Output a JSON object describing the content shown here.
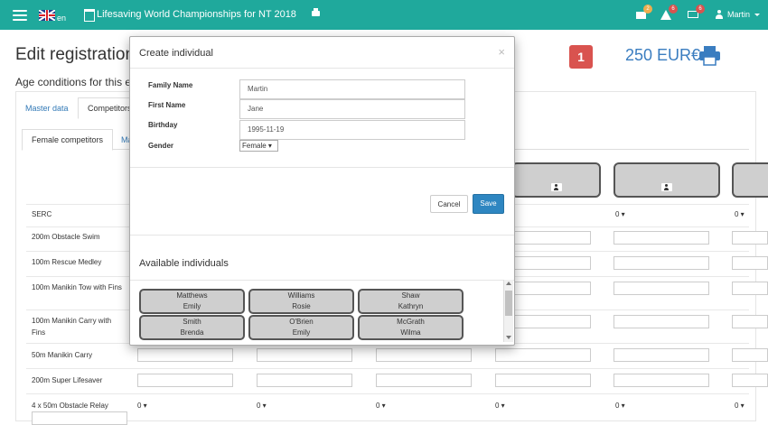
{
  "nav": {
    "lang": "en",
    "title": "Lifesaving World Championships for NT 2018",
    "username": "Martin",
    "badges": {
      "messages": "2",
      "alerts": "6",
      "payments": "6"
    },
    "colors": {
      "bar": "#1fa99c",
      "messages_badge": "#f0ad4e",
      "alerts_badge": "#d9534f"
    }
  },
  "page": {
    "title": "Edit registration",
    "age_text": "Age conditions for this eve",
    "count_badge": "1",
    "price": "250 EUR€",
    "tabs": [
      "Master data",
      "Competitors"
    ],
    "subtabs": [
      "Female competitors",
      "Ma"
    ]
  },
  "table": {
    "rows": [
      "SERC",
      "200m Obstacle Swim",
      "100m Rescue Medley",
      "100m Manikin Tow with Fins",
      "100m Manikin Carry with Fins",
      "50m Manikin Carry",
      "200m Super Lifesaver",
      "4 x 50m Obstacle Relay"
    ],
    "select_value": "0 ▾"
  },
  "modal": {
    "title": "Create individual",
    "close": "×",
    "fields": {
      "family_label": "Family Name",
      "family_value": "Martin",
      "first_label": "First Name",
      "first_value": "Jane",
      "birthday_label": "Birthday",
      "birthday_value": "1995-11-19",
      "gender_label": "Gender",
      "gender_value": "Female ▾"
    },
    "cancel": "Cancel",
    "save": "Save",
    "available_title": "Available individuals",
    "individuals": [
      {
        "last": "Matthews",
        "first": "Emily"
      },
      {
        "last": "Williams",
        "first": "Rosie"
      },
      {
        "last": "Shaw",
        "first": "Kathryn"
      },
      {
        "last": "Smith",
        "first": "Brenda"
      },
      {
        "last": "O'Brien",
        "first": "Emily"
      },
      {
        "last": "McGrath",
        "first": "Wilma"
      }
    ]
  }
}
